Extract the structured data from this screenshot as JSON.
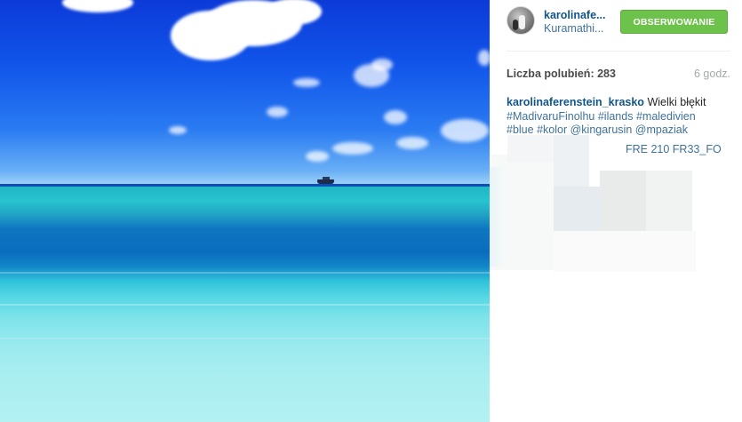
{
  "post": {
    "username": "karolinafe...",
    "location": "Kuramathi...",
    "follow_label": "OBSERWOWANIE",
    "likes_label": "Liczba polubień:",
    "likes_count": "283",
    "time_ago": "6 godz.",
    "caption": {
      "author": "karolinaferenstein_krasko",
      "text": "Wielki błękit",
      "tags": [
        "#MadivaruFinolhu",
        "#ilands",
        "#maledivien",
        "#blue",
        "#kolor",
        "@kingarusin",
        "@mpaziak"
      ]
    },
    "partial_comment": "FRE 210 FR33_FO"
  },
  "colors": {
    "follow_button": "#6cc24a",
    "link": "#125688",
    "hashtag": "#3f729b",
    "muted": "#a5a7aa"
  },
  "icons": {
    "avatar": "user-avatar"
  }
}
